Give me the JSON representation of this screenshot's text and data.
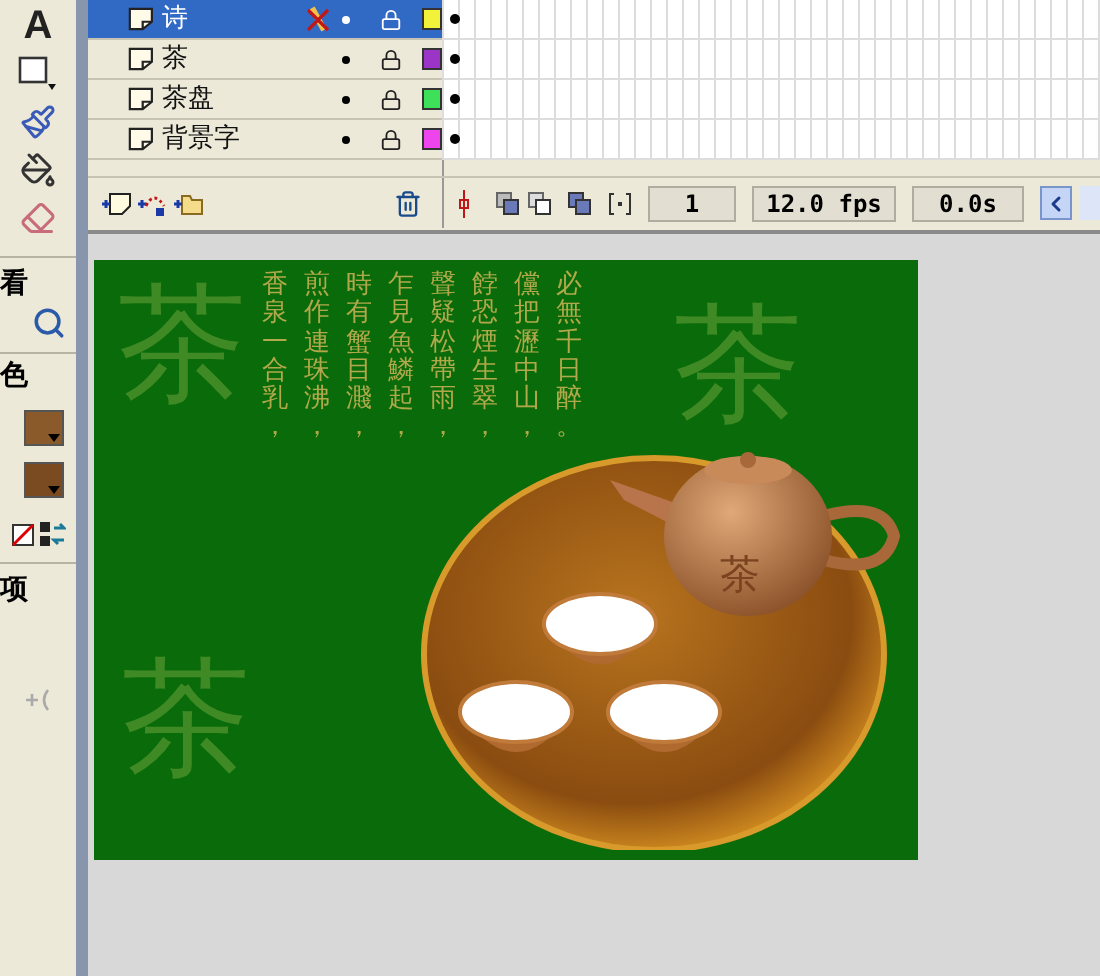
{
  "tools": {
    "text_tool": "A",
    "view_label": "看",
    "color_label": "色",
    "options_label": "项"
  },
  "layers": [
    {
      "name": "诗",
      "selected": true,
      "color": "#f2f23a"
    },
    {
      "name": "茶",
      "selected": false,
      "color": "#9a35c8"
    },
    {
      "name": "茶盘",
      "selected": false,
      "color": "#3ee05a"
    },
    {
      "name": "背景字",
      "selected": false,
      "color": "#ee44ee"
    }
  ],
  "timeline_status": {
    "frame": "1",
    "rate": "12.0 fps",
    "time": "0.0s"
  },
  "stage": {
    "poem_columns": [
      "香泉一合乳，",
      "煎作連珠沸，",
      "時有蟹目濺，",
      "乍見魚鱗起，",
      "聲疑松帶雨，",
      "餑恐煙生翠，",
      "儻把瀝中山，",
      "必無千日醉。"
    ],
    "background_characters": [
      "茶",
      "茶",
      "茶"
    ],
    "teapot_character": "茶"
  }
}
